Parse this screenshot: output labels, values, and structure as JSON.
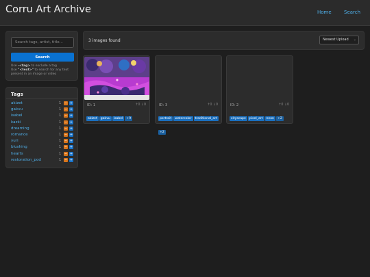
{
  "header": {
    "title": "Corru Art Archive",
    "nav": [
      {
        "label": "Home"
      },
      {
        "label": "Search"
      }
    ]
  },
  "search": {
    "placeholder": "Search tags, artist, title...",
    "button_label": "Search",
    "help_1": "Use ",
    "help_tag_syntax": "-<tag>",
    "help_2": " to exclude a tag",
    "help_3": "Use ",
    "help_text_syntax": "\"<text>\"",
    "help_4": " to search for any text present in an image or video"
  },
  "tags": {
    "title": "Tags",
    "minus_label": "−",
    "plus_label": "+",
    "items": [
      {
        "name": "akizet",
        "count": "1"
      },
      {
        "name": "gakvu",
        "count": "1"
      },
      {
        "name": "isabel",
        "count": "1"
      },
      {
        "name": "kazki",
        "count": "1"
      },
      {
        "name": "dreaming",
        "count": "1"
      },
      {
        "name": "romance",
        "count": "1"
      },
      {
        "name": "yuri",
        "count": "1"
      },
      {
        "name": "blushing",
        "count": "1"
      },
      {
        "name": "hearts",
        "count": "1"
      },
      {
        "name": "restoration_pod",
        "count": "1"
      }
    ]
  },
  "results": {
    "count_label": "3 images found",
    "sort_selected": "Newest Upload",
    "sort_caret": "⌄"
  },
  "cards": [
    {
      "id_label": "ID: 1",
      "stats": "↑0 ↓0",
      "tags": [
        "akizet",
        "gakvu",
        "isabel"
      ],
      "more": "+9",
      "thumb": "art"
    },
    {
      "id_label": "ID: 3",
      "stats": "↑0 ↓0",
      "tags": [
        "portrait",
        "watercolor",
        "traditional_art"
      ],
      "more": "+2",
      "thumb": "empty"
    },
    {
      "id_label": "ID: 2",
      "stats": "↑0 ↓0",
      "tags": [
        "cityscape",
        "pixel_art",
        "neon"
      ],
      "more": "+2",
      "thumb": "empty"
    }
  ],
  "colors": {
    "accent": "#0a72d1",
    "link": "#4fb0ea",
    "exclude": "#d9761c",
    "background": "#1e1e1e",
    "panel": "#2c2c2c"
  }
}
